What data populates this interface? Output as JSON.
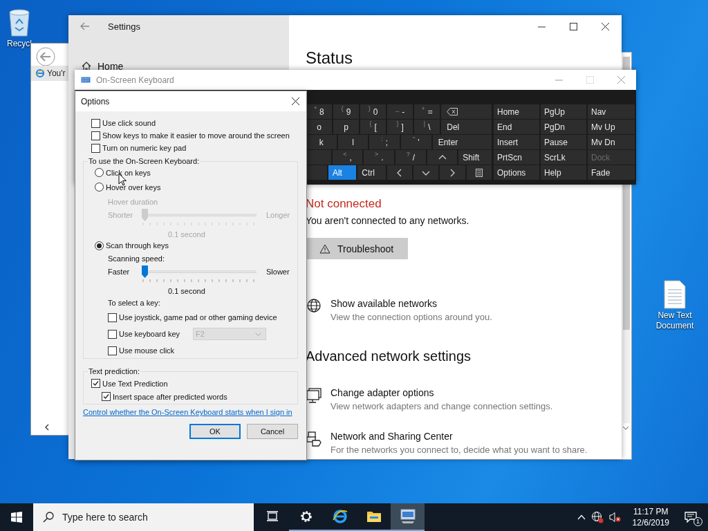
{
  "desktop": {
    "icons": [
      {
        "kind": "recycle-bin",
        "label": "Recycl"
      },
      {
        "kind": "text-document",
        "label": "New Text Document"
      }
    ]
  },
  "browser_window": {
    "tab_title": "You'r"
  },
  "settings": {
    "title": "Settings",
    "nav": [
      {
        "label": "Home"
      }
    ],
    "heading": "Status",
    "status": "Not connected",
    "status_detail": "You aren't connected to any networks.",
    "troubleshoot": "Troubleshoot",
    "links": [
      {
        "kind": "globe",
        "title": "Show available networks",
        "subtitle": "View the connection options around you."
      }
    ],
    "section": "Advanced network settings",
    "advanced": [
      {
        "kind": "adapter",
        "title": "Change adapter options",
        "subtitle": "View network adapters and change connection settings."
      },
      {
        "kind": "sharing",
        "title": "Network and Sharing Center",
        "subtitle": "For the networks you connect to, decide what you want to share."
      }
    ]
  },
  "keyboard": {
    "title": "On-Screen Keyboard",
    "rows": [
      [
        {
          "kind": "char",
          "shift": "*",
          "label": "8"
        },
        {
          "kind": "char",
          "shift": "(",
          "label": "9"
        },
        {
          "kind": "char",
          "shift": ")",
          "label": "0"
        },
        {
          "kind": "char",
          "shift": "_",
          "label": "-"
        },
        {
          "kind": "char",
          "shift": "+",
          "label": "="
        },
        {
          "kind": "backspace"
        }
      ],
      [
        {
          "kind": "char",
          "label": "o"
        },
        {
          "kind": "char",
          "label": "p"
        },
        {
          "kind": "char",
          "shift": "{",
          "label": "["
        },
        {
          "kind": "char",
          "shift": "}",
          "label": "]"
        },
        {
          "kind": "char",
          "shift": "|",
          "label": "\\"
        },
        {
          "kind": "wide",
          "label": "Del"
        }
      ],
      [
        {
          "kind": "char",
          "label": "k"
        },
        {
          "kind": "char",
          "label": "l"
        },
        {
          "kind": "char",
          "shift": ":",
          "label": ";"
        },
        {
          "kind": "char",
          "shift": "\"",
          "label": "'"
        },
        {
          "kind": "wide",
          "label": "Enter"
        }
      ],
      [
        {
          "kind": "blank"
        },
        {
          "kind": "char",
          "shift": "<",
          "label": ","
        },
        {
          "kind": "char",
          "shift": ">",
          "label": "."
        },
        {
          "kind": "char",
          "shift": "?",
          "label": "/"
        },
        {
          "kind": "up"
        },
        {
          "kind": "toggle",
          "label": "Shift",
          "on": false
        }
      ],
      [
        {
          "kind": "blank"
        },
        {
          "kind": "toggle",
          "label": "Alt",
          "on": true
        },
        {
          "kind": "toggle",
          "label": "Ctrl",
          "on": false
        },
        {
          "kind": "left"
        },
        {
          "kind": "down"
        },
        {
          "kind": "right"
        },
        {
          "kind": "menu"
        }
      ]
    ],
    "nav_keys": [
      {
        "label": "Home",
        "disabled": false
      },
      {
        "label": "PgUp",
        "disabled": false
      },
      {
        "label": "Nav",
        "disabled": false
      },
      {
        "label": "End",
        "disabled": false
      },
      {
        "label": "PgDn",
        "disabled": false
      },
      {
        "label": "Mv Up",
        "disabled": false
      },
      {
        "label": "Insert",
        "disabled": false
      },
      {
        "label": "Pause",
        "disabled": false
      },
      {
        "label": "Mv Dn",
        "disabled": false
      },
      {
        "label": "PrtScn",
        "disabled": false
      },
      {
        "label": "ScrLk",
        "disabled": false
      },
      {
        "label": "Dock",
        "disabled": true
      },
      {
        "label": "Options",
        "disabled": false
      },
      {
        "label": "Help",
        "disabled": false
      },
      {
        "label": "Fade",
        "disabled": false
      }
    ]
  },
  "options": {
    "title": "Options",
    "general": [
      {
        "label": "Use click sound",
        "checked": false
      },
      {
        "label": "Show keys to make it easier to move around the screen",
        "checked": false
      },
      {
        "label": "Turn on numeric key pad",
        "checked": false
      }
    ],
    "use_group": {
      "label": "To use the On-Screen Keyboard:",
      "modes": [
        {
          "label": "Click on keys",
          "selected": false
        },
        {
          "label": "Hover over keys",
          "selected": false
        },
        {
          "label": "Scan through keys",
          "selected": true
        }
      ],
      "hover": {
        "label": "Hover duration",
        "min": "Shorter",
        "max": "Longer",
        "level": 0,
        "reading": "0.1 second",
        "disabled": true
      },
      "scan": {
        "label": "Scanning speed:",
        "min": "Faster",
        "max": "Slower",
        "level": 0,
        "reading": "0.1 second",
        "disabled": false
      },
      "select_label": "To select a key:",
      "select": [
        {
          "kind": "checkbox",
          "label": "Use joystick, game pad or other gaming device",
          "checked": false
        },
        {
          "kind": "dropdown",
          "label": "Use keyboard key",
          "checked": false,
          "value": "F2",
          "disabled": true
        },
        {
          "kind": "checkbox",
          "label": "Use mouse click",
          "checked": false
        }
      ]
    },
    "prediction": {
      "label": "Text prediction:",
      "items": [
        {
          "label": "Use Text Prediction",
          "checked": true,
          "children": [
            {
              "label": "Insert space after predicted words",
              "checked": true
            }
          ]
        }
      ]
    },
    "link": "Control whether the On-Screen Keyboard starts when I sign in",
    "buttons": [
      {
        "label": "OK",
        "default": true
      },
      {
        "label": "Cancel",
        "default": false
      }
    ]
  },
  "taskbar": {
    "search_placeholder": "Type here to search",
    "apps": [
      {
        "kind": "task-view",
        "running": false,
        "selected": false
      },
      {
        "kind": "gear",
        "running": true,
        "selected": false
      },
      {
        "kind": "browser",
        "running": true,
        "selected": false
      },
      {
        "kind": "folder",
        "running": true,
        "selected": false
      },
      {
        "kind": "keyboard",
        "running": true,
        "selected": true
      }
    ],
    "time": "11:17 PM",
    "date": "12/6/2019",
    "notifications": "1"
  }
}
